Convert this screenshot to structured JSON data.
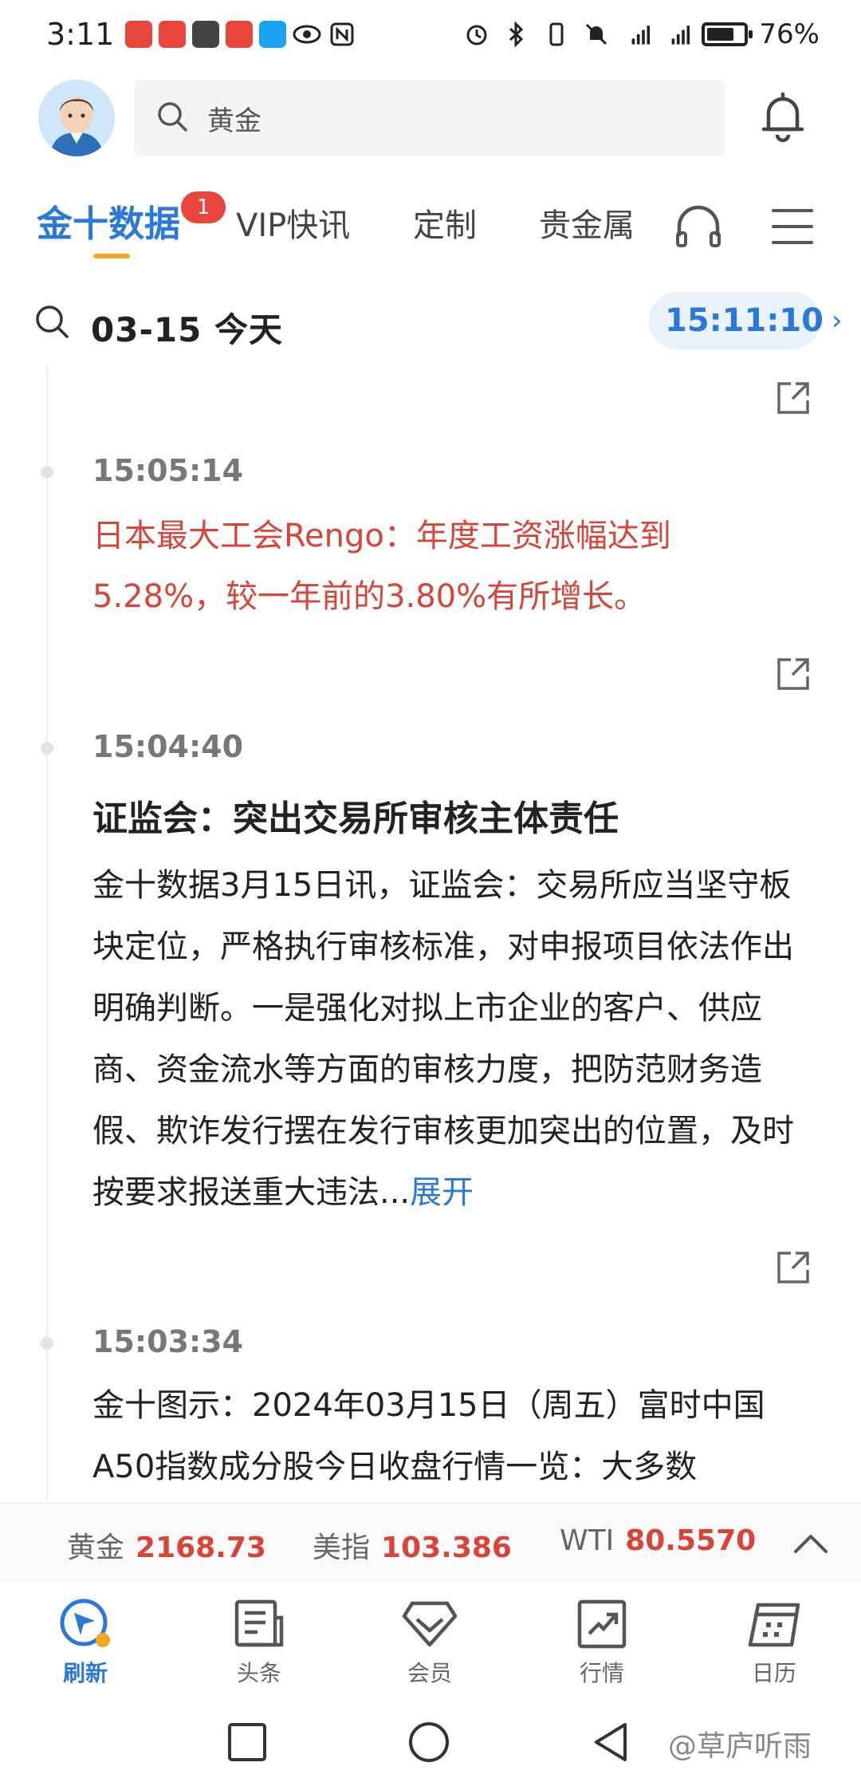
{
  "status_bar": {
    "time": "3:11",
    "battery_percent": "76%",
    "battery_level": 0.76
  },
  "header": {
    "search_text": "黄金"
  },
  "tabs": [
    {
      "label": "金十数据",
      "badge": "1"
    },
    {
      "label": "VIP快讯"
    },
    {
      "label": "定制"
    },
    {
      "label": "贵金属"
    }
  ],
  "date_row": {
    "date_label": "03-15 今天",
    "current_time": "15:11:10"
  },
  "feed": [
    {
      "time": "15:05:14",
      "text": "日本最大工会Rengo：年度工资涨幅达到5.28%，较一年前的3.80%有所增长。",
      "important": true
    },
    {
      "time": "15:04:40",
      "title": "证监会：突出交易所审核主体责任",
      "text": "金十数据3月15日讯，证监会：交易所应当坚守板块定位，严格执行审核标准，对申报项目依法作出明确判断。一是强化对拟上市企业的客户、供应商、资金流水等方面的审核力度，把防范财务造假、欺诈发行摆在发行审核更加突出的位置，及时按要求报送重大违法...",
      "expand_label": "展开"
    },
    {
      "time": "15:03:34",
      "text": "金十图示：2024年03月15日（周五）富时中国A50指数成分股今日收盘行情一览：大多数"
    }
  ],
  "ticker": [
    {
      "name": "黄金",
      "value": "2168.73"
    },
    {
      "name": "美指",
      "value": "103.386"
    },
    {
      "name": "WTI",
      "value": "80.5570"
    }
  ],
  "bottom_nav": [
    {
      "label": "刷新",
      "icon": "refresh-compass-icon"
    },
    {
      "label": "头条",
      "icon": "newspaper-icon"
    },
    {
      "label": "会员",
      "icon": "diamond-icon"
    },
    {
      "label": "行情",
      "icon": "trend-chart-icon"
    },
    {
      "label": "日历",
      "icon": "calendar-icon"
    }
  ],
  "watermark": "@草庐听雨",
  "colors": {
    "accent": "#2a78d8",
    "alert_red": "#d8443a",
    "tab_underline": "#f5a623"
  }
}
